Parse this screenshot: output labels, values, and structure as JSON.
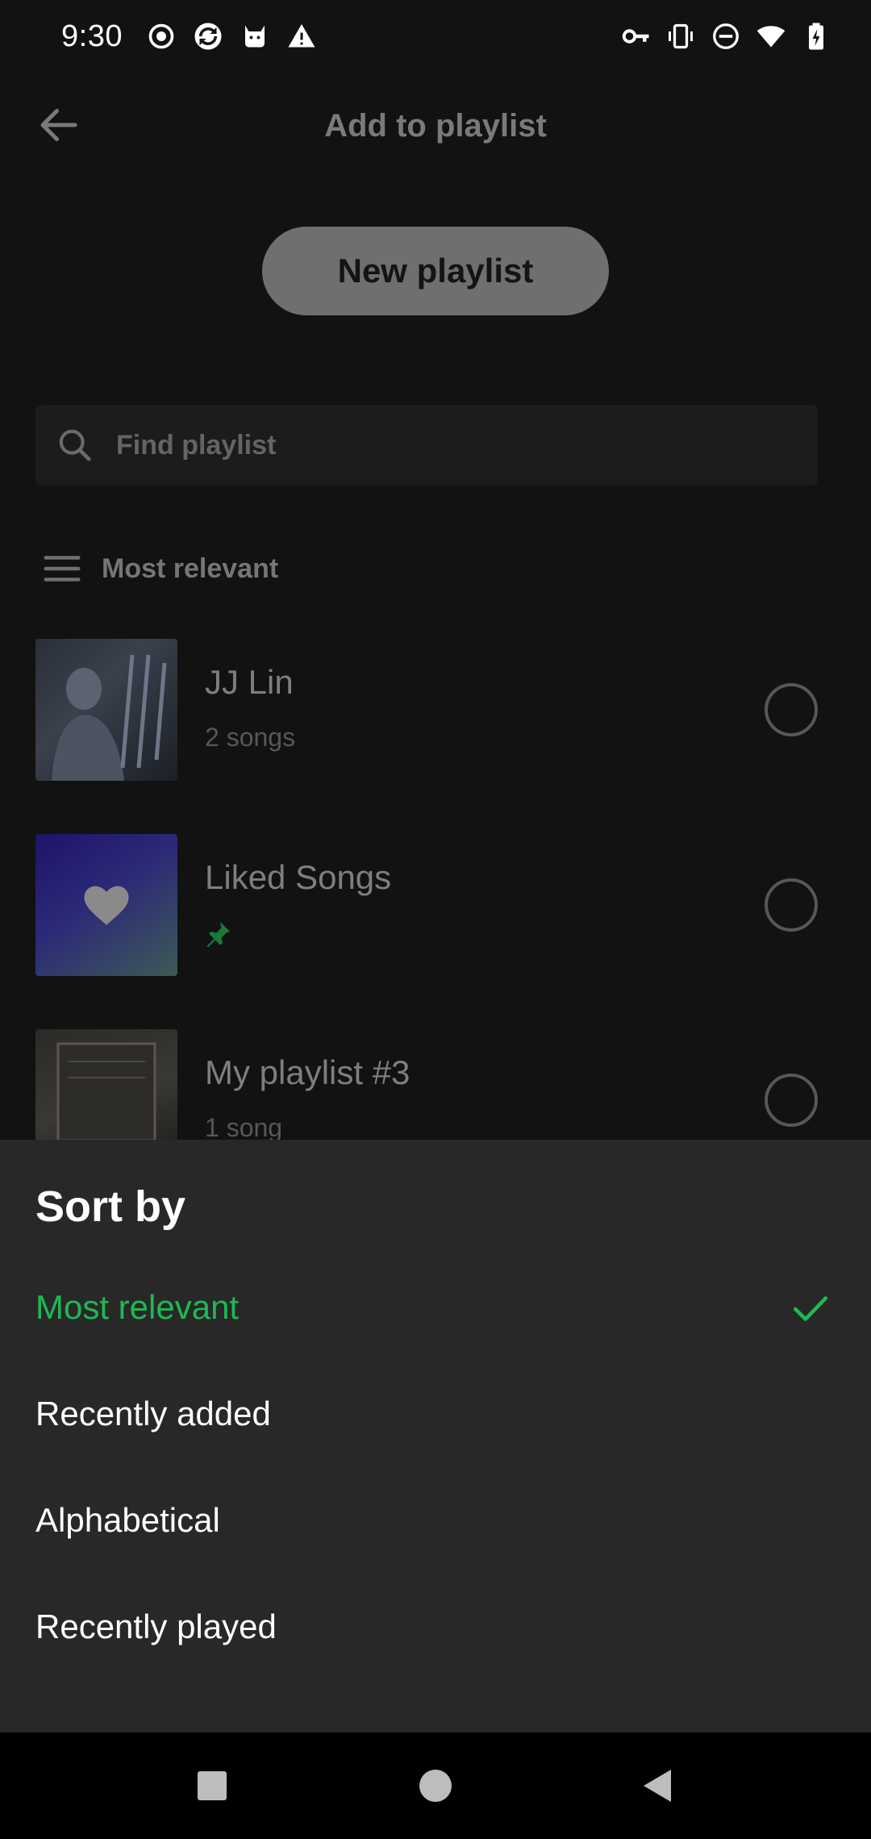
{
  "status_bar": {
    "time": "9:30",
    "left_icons": [
      "record-icon",
      "sync-icon",
      "cat-icon",
      "warning-icon"
    ],
    "right_icons": [
      "vpn-key-icon",
      "vibrate-icon",
      "do-not-disturb-icon",
      "wifi-icon",
      "battery-charging-icon"
    ]
  },
  "app_bar": {
    "title": "Add to playlist",
    "back_icon": "arrow-left-icon"
  },
  "new_playlist_label": "New playlist",
  "search": {
    "placeholder": "Find playlist",
    "icon": "search-icon"
  },
  "sort": {
    "current_label": "Most relevant",
    "icon": "sort-lines-icon"
  },
  "playlists": [
    {
      "title": "JJ Lin",
      "subtitle": "2 songs",
      "selected": false
    },
    {
      "title": "Liked Songs",
      "subtitle": "",
      "pinned": true,
      "selected": false
    },
    {
      "title": "My playlist #3",
      "subtitle": "1 song",
      "selected": false
    }
  ],
  "sheet": {
    "title": "Sort by",
    "options": [
      {
        "label": "Most relevant",
        "selected": true
      },
      {
        "label": "Recently added",
        "selected": false
      },
      {
        "label": "Alphabetical",
        "selected": false
      },
      {
        "label": "Recently played",
        "selected": false
      }
    ]
  },
  "colors": {
    "accent": "#1db954",
    "sheet_bg": "#282828",
    "background": "#121212"
  },
  "nav_bar": {
    "icons": [
      "recents-square-icon",
      "home-circle-icon",
      "back-triangle-icon"
    ]
  }
}
